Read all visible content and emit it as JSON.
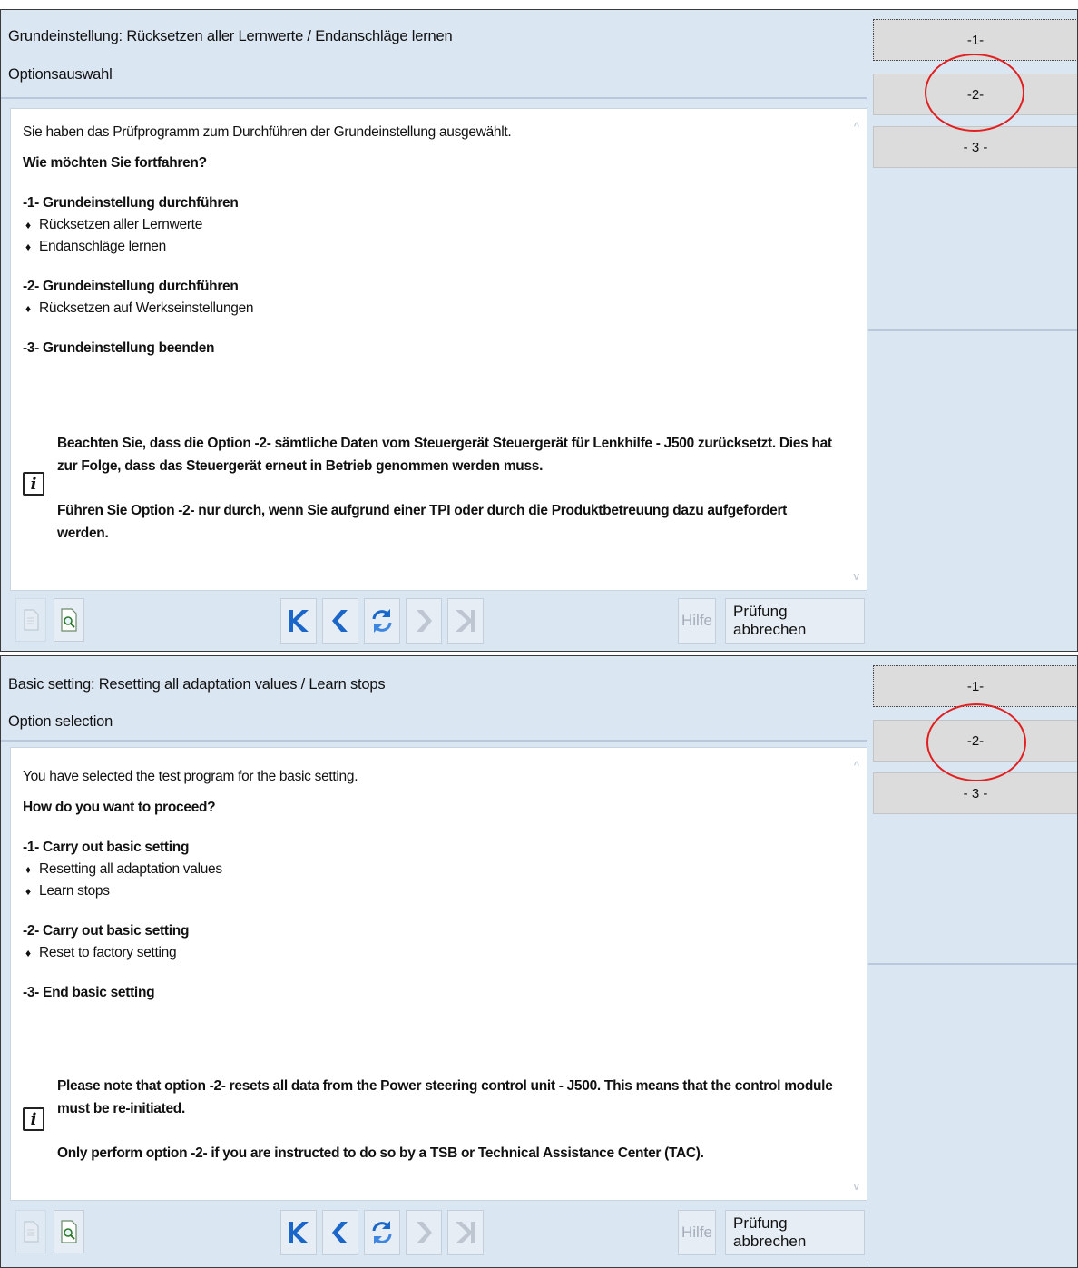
{
  "screens": [
    {
      "lang": "de",
      "header": {
        "title": "Grundeinstellung: Rücksetzen aller Lernwerte / Endanschläge lernen",
        "subtitle": "Optionsauswahl"
      },
      "content": {
        "intro": "Sie haben das Prüfprogramm zum Durchführen der Grundeinstellung ausgewählt.",
        "question": "Wie möchten Sie fortfahren?",
        "options": [
          {
            "title": "-1- Grundeinstellung durchführen",
            "bullets": [
              "Rücksetzen aller Lernwerte",
              "Endanschläge lernen"
            ]
          },
          {
            "title": "-2- Grundeinstellung durchführen",
            "bullets": [
              "Rücksetzen auf Werkseinstellungen"
            ]
          },
          {
            "title": "-3- Grundeinstellung beenden",
            "bullets": []
          }
        ],
        "info": {
          "line1": "Beachten Sie, dass die Option -2- sämtliche Daten vom Steuergerät Steuergerät für Lenkhilfe - J500 zurücksetzt. Dies hat zur Folge, dass das Steuergerät erneut in Betrieb genommen werden muss.",
          "line2": "Führen Sie Option -2- nur durch, wenn Sie aufgrund einer TPI oder durch die Produktbetreuung dazu aufgefordert werden."
        }
      },
      "toolbar": {
        "help_label": "Hilfe",
        "cancel_label": "Prüfung abbrechen"
      },
      "side_buttons": [
        "-1-",
        "-2-",
        "- 3 -"
      ]
    },
    {
      "lang": "en",
      "header": {
        "title": "Basic setting: Resetting all adaptation values / Learn stops",
        "subtitle": "Option selection"
      },
      "content": {
        "intro": "You have selected the test program for the basic setting.",
        "question": "How do you want to proceed?",
        "options": [
          {
            "title": "-1- Carry out basic setting",
            "bullets": [
              "Resetting all adaptation values",
              "Learn stops"
            ]
          },
          {
            "title": "-2- Carry out basic setting",
            "bullets": [
              "Reset to factory setting"
            ]
          },
          {
            "title": "-3- End basic setting",
            "bullets": []
          }
        ],
        "info": {
          "line1": "Please note that option -2- resets all data from the Power steering control unit - J500. This means that the control module must be re-initiated.",
          "line2": "Only perform option -2- if you are instructed to do so by a TSB or Technical Assistance Center (TAC)."
        }
      },
      "toolbar": {
        "help_label": "Hilfe",
        "cancel_label": "Prüfung abbrechen"
      },
      "side_buttons": [
        "-1-",
        "-2-",
        "- 3 -"
      ]
    }
  ],
  "icons": {
    "info": "i",
    "bullet": "♦",
    "nav_first": "K",
    "nav_prev": "❮",
    "nav_refresh": "⟳",
    "nav_next": "❯",
    "nav_last": "❯|",
    "scroll_up": "^",
    "scroll_down": "v"
  },
  "colors": {
    "panel_bg": "#dbe6f3",
    "nav_active": "#1b66c9",
    "annotation_ring": "#e02020"
  }
}
